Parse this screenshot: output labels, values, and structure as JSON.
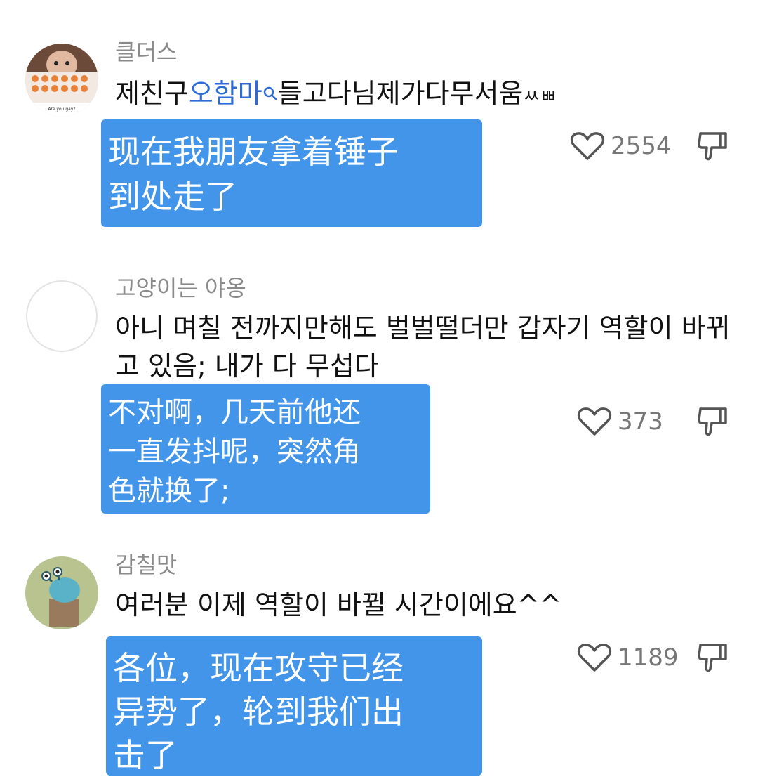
{
  "comments": [
    {
      "username": "클더스",
      "text_before": "제친구",
      "mention": "오함마",
      "text_after": "들고다님제가다무서움",
      "text_tail": "ㅆㅃ",
      "avatar_caption": "Are you gay?",
      "translation": "现在我朋友拿着锤子\n到处走了",
      "likes": "2554"
    },
    {
      "username": "고양이는 야옹",
      "text": "아니 며칠 전까지만해도 벌벌떨더만 갑자기 역할이 바뀌고 있음; 내가 다 무섭다",
      "translation": "不对啊，几天前他还\n一直发抖呢，突然角\n色就换了;",
      "likes": "373"
    },
    {
      "username": "감칠맛",
      "text": "여러분 이제 역할이 바뀔 시간이에요^^",
      "translation": "各位，现在攻守已经\n异势了，轮到我们出\n击了",
      "likes": "1189"
    }
  ],
  "icons": {
    "like": "heart-outline-icon",
    "dislike": "thumbs-down-icon",
    "mention": "search-icon"
  },
  "colors": {
    "overlay": "#4295e8",
    "mention": "#2f6bd6",
    "username": "#8a8a8a",
    "count": "#777777"
  }
}
